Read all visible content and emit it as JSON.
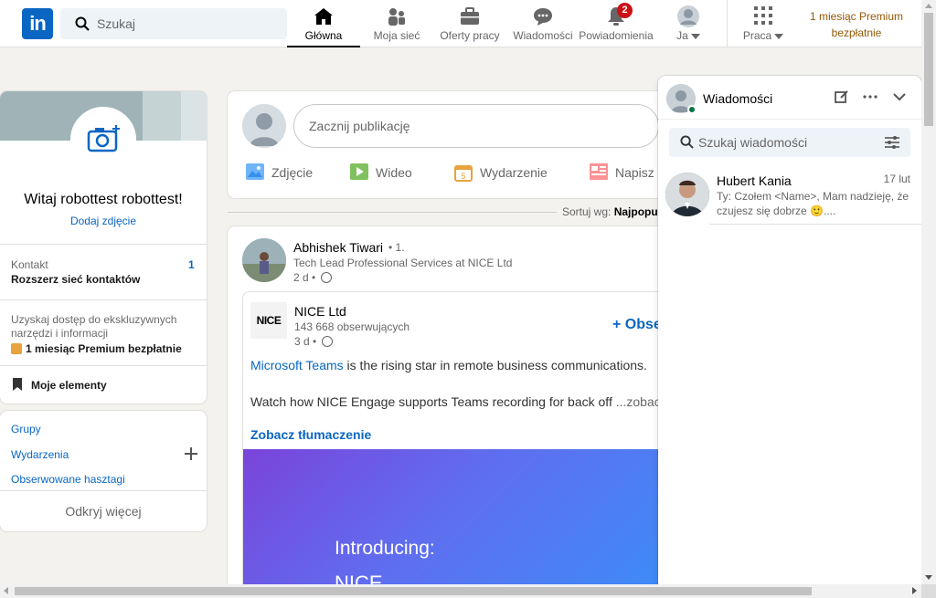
{
  "nav": {
    "logo": "in",
    "search_placeholder": "Szukaj",
    "items": [
      {
        "label": "Główna"
      },
      {
        "label": "Moja sieć"
      },
      {
        "label": "Oferty pracy"
      },
      {
        "label": "Wiadomości"
      },
      {
        "label": "Powiadomienia",
        "badge": "2"
      },
      {
        "label": "Ja"
      },
      {
        "label": "Praca"
      }
    ],
    "premium_line1": "1 miesiąc Premium",
    "premium_line2": "bezpłatnie"
  },
  "profile": {
    "name": "Witaj robottest robottest!",
    "add_photo": "Dodaj zdjęcie",
    "contacts_label": "Kontakt",
    "contacts_sub": "Rozszerz sieć kontaktów",
    "contacts_count": "1",
    "exclusive": "Uzyskaj dostęp do ekskluzywnych narzędzi i informacji",
    "premium": "1 miesiąc Premium bezpłatnie",
    "my_items": "Moje elementy"
  },
  "groups": {
    "groups": "Grupy",
    "events": "Wydarzenia",
    "hashtags": "Obserwowane hasztagi",
    "discover": "Odkryj więcej"
  },
  "share": {
    "start": "Zacznij publikację",
    "photo": "Zdjęcie",
    "video": "Wideo",
    "event": "Wydarzenie",
    "write": "Napisz"
  },
  "sort": {
    "label": "Sortuj wg:",
    "value": "Najpopul"
  },
  "post": {
    "author": "Abhishek Tiwari",
    "degree": "• 1.",
    "title": "Tech Lead Professional Services at NICE Ltd",
    "time": "2 d •",
    "company": "NICE Ltd",
    "company_logo": "NICE",
    "followers": "143 668 obserwujących",
    "company_time": "3 d •",
    "follow": "+ Obse",
    "text_link": "Microsoft Teams",
    "text1": " is the rising star in remote business communications.",
    "text2": "Watch how NICE Engage supports Teams recording for back off",
    "more": " ...zobacz",
    "translate": "Zobacz tłumaczenie",
    "promo_intro": "Introducing:",
    "promo_big": "NICE"
  },
  "messaging": {
    "title": "Wiadomości",
    "search_placeholder": "Szukaj wiadomości",
    "conversations": [
      {
        "name": "Hubert Kania",
        "date": "17 lut",
        "preview": "Ty: Czołem <Name>, Mam nadzieję, że czujesz się dobrze 🙂...."
      }
    ]
  },
  "colors": {
    "brand": "#0a66c2",
    "premium": "#915907",
    "badge": "#cc1016",
    "online": "#057642"
  }
}
